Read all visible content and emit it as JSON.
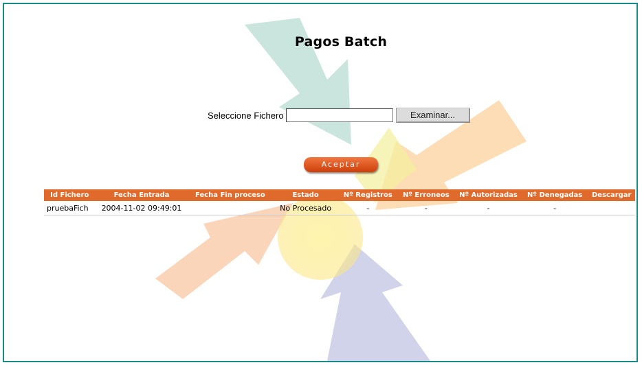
{
  "page": {
    "title": "Pagos Batch"
  },
  "upload": {
    "label": "Seleccione Fichero",
    "file_value": "",
    "browse_label": "Examinar...",
    "accept_label": "Aceptar"
  },
  "table": {
    "headers": [
      "Id Fichero",
      "Fecha Entrada",
      "Fecha Fin proceso",
      "Estado",
      "Nº Registros",
      "Nº Erroneos",
      "Nº Autorizadas",
      "Nº Denegadas",
      "Descargar"
    ],
    "rows": [
      [
        "pruebaFich",
        "2004-11-02 09:49:01",
        "",
        "No Procesado",
        "-",
        "-",
        "-",
        "-",
        ""
      ]
    ]
  },
  "colors": {
    "border": "#1a8a86",
    "header_bg": "#e06a2c",
    "accept_button": "#e05a1e"
  }
}
